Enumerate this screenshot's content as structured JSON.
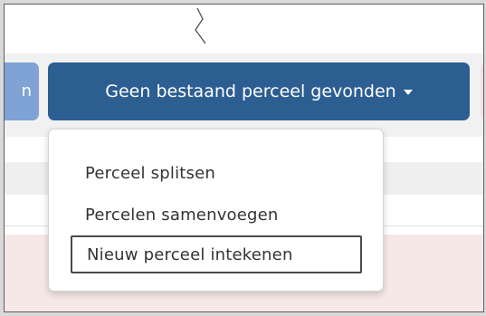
{
  "toolbar": {
    "left_partial_button_label": "n",
    "main_button_label": "Geen bestaand perceel gevonden",
    "main_button_caret_icon": "chevron-down-icon"
  },
  "dropdown": {
    "items": [
      {
        "label": "Perceel splitsen"
      },
      {
        "label": "Percelen samenvoegen"
      },
      {
        "label": "Nieuw perceel intekenen"
      }
    ]
  },
  "colors": {
    "primary": "#2c5e92",
    "primary_light": "#7ea3d4",
    "danger_light": "#f7dede",
    "menu_text": "#333333",
    "background": "#ffffff",
    "toolbar_bg": "#f1f1f1",
    "pink_area": "#f7e8e8"
  }
}
